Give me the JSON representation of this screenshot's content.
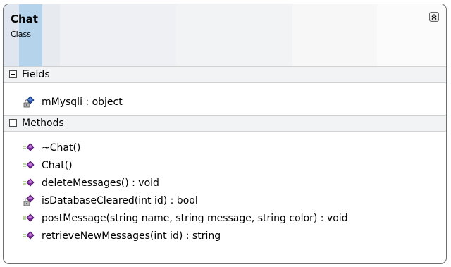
{
  "class_shape": {
    "name": "Chat",
    "kind": "Class"
  },
  "fields_section": {
    "label": "Fields",
    "items": [
      {
        "text": "mMysqli : object",
        "icon": "private-field-icon"
      }
    ]
  },
  "methods_section": {
    "label": "Methods",
    "items": [
      {
        "text": "~Chat()",
        "icon": "method-icon"
      },
      {
        "text": "Chat()",
        "icon": "method-icon"
      },
      {
        "text": "deleteMessages() : void",
        "icon": "method-icon"
      },
      {
        "text": "isDatabaseCleared(int id) : bool",
        "icon": "private-method-icon"
      },
      {
        "text": "postMessage(string name, string message, string color) : void",
        "icon": "method-icon"
      },
      {
        "text": "retrieveNewMessages(int id) : string",
        "icon": "method-icon"
      }
    ]
  },
  "colors": {
    "method_purple": "#7b2a9b",
    "field_blue": "#1f4ea8",
    "border": "#6e6e6e"
  }
}
